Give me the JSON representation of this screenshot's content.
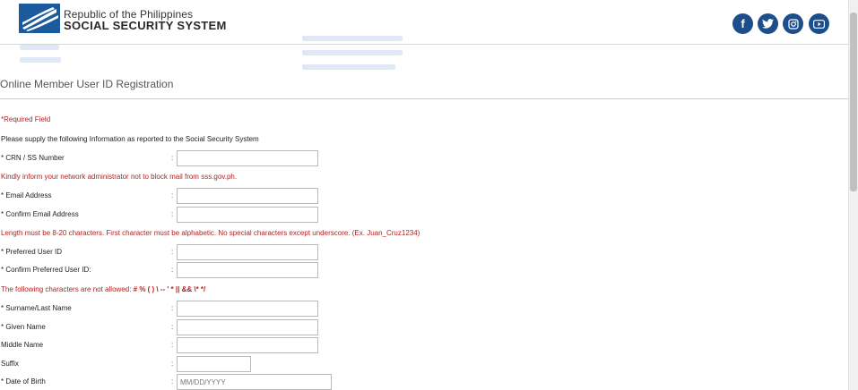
{
  "header": {
    "org_line1": "Republic of the Philippines",
    "org_line2": "SOCIAL SECURITY SYSTEM",
    "social": [
      "f",
      "t",
      "◎",
      "▶"
    ]
  },
  "page": {
    "title": "Online Member User ID Registration",
    "required_note": "*Required Field",
    "supply_text": "Please supply the following Information as reported to the Social Security System",
    "notice_email": "Kindly inform your network administrator not to block mail from sss.gov.ph.",
    "notice_userid": "Length must be 8-20 characters. First character must be alphabetic. No special characters except underscore. (Ex. Juan_Cruz1234)",
    "notice_chars_prefix": "The following characters are not allowed: ",
    "notice_chars_list": "# % ( ) \\ -- ' * || && \\* */"
  },
  "fields": {
    "crn": {
      "label": "* CRN / SS Number",
      "colon": ":"
    },
    "email": {
      "label": "* Email Address",
      "colon": ":"
    },
    "confirm_email": {
      "label": "* Confirm Email Address",
      "colon": ":"
    },
    "userid": {
      "label": "* Preferred User ID",
      "colon": ":"
    },
    "confirm_userid": {
      "label": "* Confirm Preferred User ID:",
      "colon": ":"
    },
    "surname": {
      "label": "* Surname/Last Name",
      "colon": ":"
    },
    "given": {
      "label": "* Given Name",
      "colon": ":"
    },
    "middle": {
      "label": "Middle Name",
      "colon": ":"
    },
    "suffix": {
      "label": "Suffix",
      "colon": ":"
    },
    "dob": {
      "label": "* Date of Birth",
      "colon": ":",
      "placeholder": "MM/DD/YYYY"
    }
  },
  "colors": {
    "brand": "#1b5a9c",
    "social": "#1c4e8c",
    "notice": "#b22222"
  }
}
